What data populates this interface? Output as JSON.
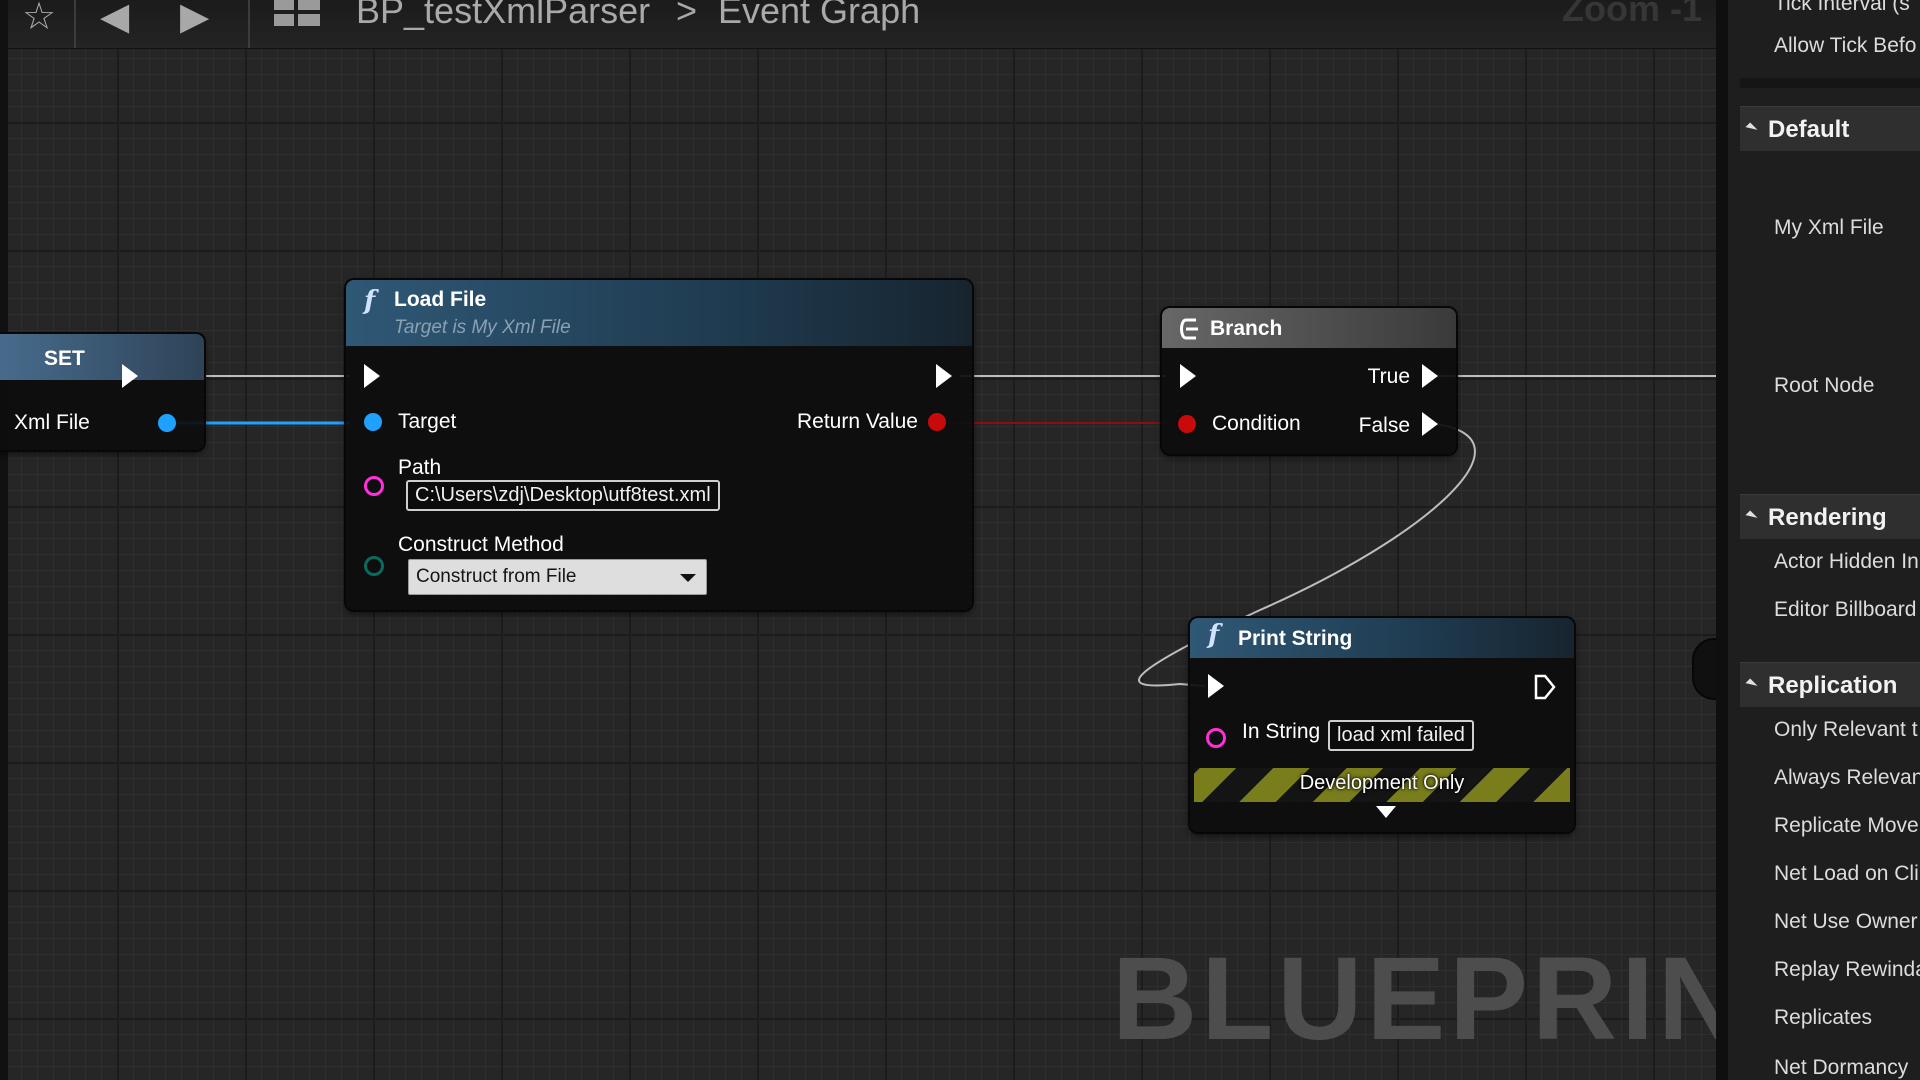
{
  "toolbar": {
    "breadcrumb_blueprint": "BP_testXmlParser",
    "breadcrumb_separator": ">",
    "breadcrumb_graph": "Event Graph",
    "zoom": "Zoom -1",
    "icons": [
      "star-icon",
      "back-arrow-icon",
      "forward-arrow-icon",
      "blueprint-icon"
    ]
  },
  "nodes": {
    "set": {
      "title": "SET",
      "variable_label": "Xml File",
      "header_color": "#4a6f92"
    },
    "load_file": {
      "title": "Load File",
      "subtitle": "Target is My Xml File",
      "target_label": "Target",
      "return_label": "Return Value",
      "path_label": "Path",
      "path_value": "C:\\Users\\zdj\\Desktop\\utf8test.xml",
      "method_label": "Construct Method",
      "method_value": "Construct from File",
      "header_color": "#2f5876"
    },
    "branch": {
      "title": "Branch",
      "condition_label": "Condition",
      "true_label": "True",
      "false_label": "False"
    },
    "print_string": {
      "title": "Print String",
      "in_string_label": "In String",
      "in_string_value": "load xml failed",
      "dev_only_label": "Development Only"
    }
  },
  "pin_colors": {
    "object": "#1fa2ff",
    "boolean": "#c90a0a",
    "string": "#ff2fd9",
    "enum": "#0a6a5c",
    "exec": "#ffffff"
  },
  "watermark": "BLUEPRINT",
  "details": {
    "top_items": [
      "Tick Interval (s",
      "Allow Tick Befo"
    ],
    "categories": [
      {
        "title": "Default",
        "items": [
          "My Xml File",
          "Root Node"
        ]
      },
      {
        "title": "Rendering",
        "items": [
          "Actor Hidden In",
          "Editor Billboard"
        ]
      },
      {
        "title": "Replication",
        "items": [
          "Only Relevant t",
          "Always Relevan",
          "Replicate Move",
          "Net Load on Cli",
          "Net Use Owner",
          "Replay Rewinda",
          "Replicates",
          "Net Dormancy"
        ]
      }
    ]
  }
}
